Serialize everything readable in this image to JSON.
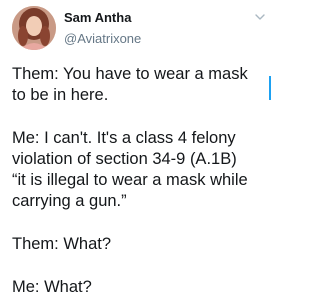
{
  "author": {
    "name": "Sam Antha",
    "handle": "@Aviatrixone",
    "avatar_icon": "profile-photo"
  },
  "menu_icon": "chevron-down-icon",
  "tweet": {
    "paragraphs": [
      "Them:  You have to wear a mask\nto be in here.",
      "Me:  I can't.  It's a class 4 felony\nviolation of section 34-9 (A.1B)\n“it is illegal to wear a mask while\ncarrying a gun.”",
      "Them:  What?",
      "Me: What?"
    ]
  },
  "colors": {
    "text": "#14171a",
    "handle": "#657786",
    "accent": "#1da1f2"
  }
}
